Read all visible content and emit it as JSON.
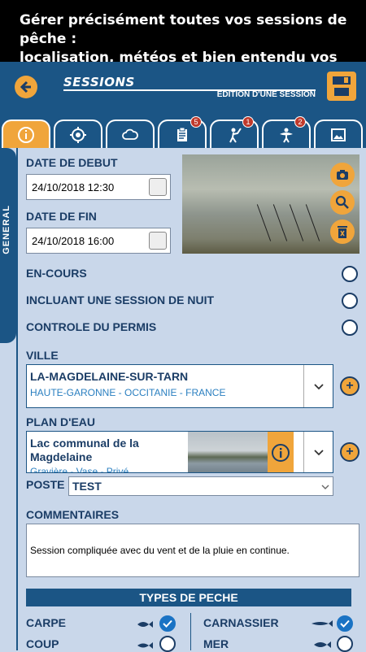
{
  "banner": {
    "line1": "Gérer précisément toutes vos sessions de pêche :",
    "line2": "localisation, météos et bien entendu vos prises",
    "bang": "!"
  },
  "header": {
    "title": "SESSIONS",
    "subtitle": "EDITION D'UNE SESSION"
  },
  "tabs": [
    {
      "name": "info",
      "badge": ""
    },
    {
      "name": "location",
      "badge": ""
    },
    {
      "name": "weather",
      "badge": ""
    },
    {
      "name": "checklist",
      "badge": "5"
    },
    {
      "name": "fisherman",
      "badge": "1"
    },
    {
      "name": "catches",
      "badge": "2"
    },
    {
      "name": "gallery",
      "badge": ""
    }
  ],
  "side_tab": "GENERAL",
  "general": {
    "start_label": "DATE DE DEBUT",
    "start_value": "24/10/2018 12:30",
    "end_label": "DATE DE FIN",
    "end_value": "24/10/2018 16:00",
    "en_cours_label": "EN-COURS",
    "night_label": "INCLUANT UNE SESSION DE NUIT",
    "permis_label": "CONTROLE DU PERMIS"
  },
  "ville": {
    "label": "VILLE",
    "name": "LA-MAGDELAINE-SUR-TARN",
    "region": "HAUTE-GARONNE - OCCITANIE - FRANCE"
  },
  "plan_eau": {
    "label": "PLAN D'EAU",
    "name": "Lac communal de la Magdelaine",
    "details": "Gravière - Vase - Privé"
  },
  "poste": {
    "label": "POSTE",
    "value": "TEST"
  },
  "commentaires": {
    "label": "COMMENTAIRES",
    "value": "Session compliquée avec du vent et de la pluie en continue."
  },
  "types": {
    "title": "TYPES DE PECHE",
    "items": [
      {
        "label": "CARPE",
        "checked": true
      },
      {
        "label": "CARNASSIER",
        "checked": true
      },
      {
        "label": "COUP",
        "checked": false
      },
      {
        "label": "MER",
        "checked": false
      }
    ]
  },
  "colors": {
    "primary": "#1b5585",
    "accent": "#f0a53b",
    "background": "#c9d7ea",
    "check": "#1a73c4"
  }
}
